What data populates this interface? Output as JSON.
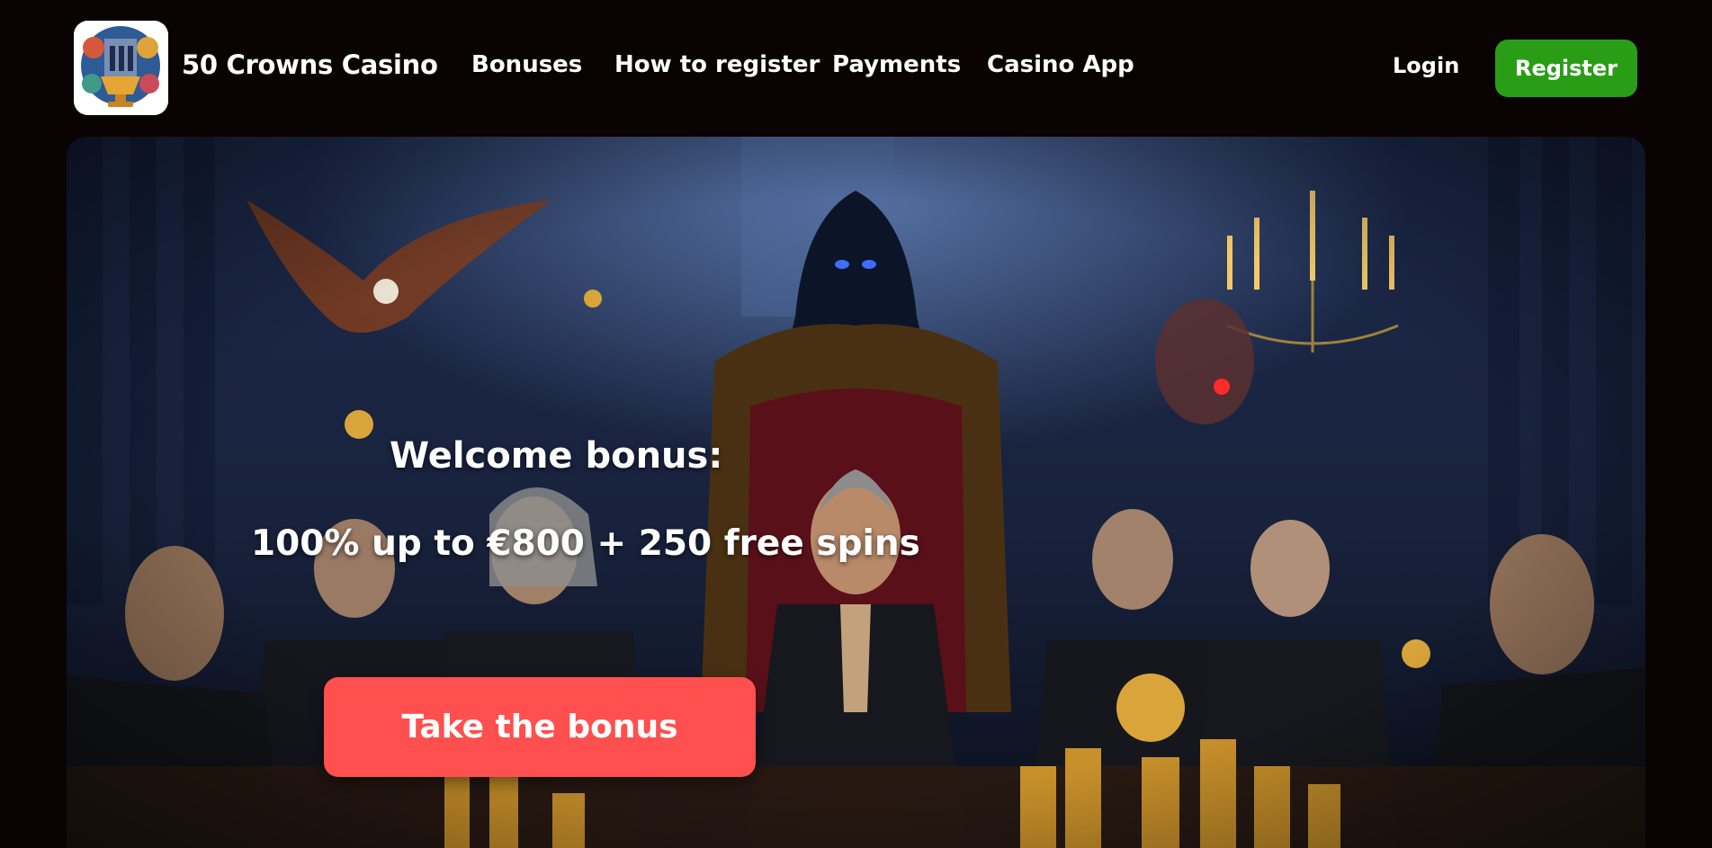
{
  "header": {
    "brand": "50 Crowns Casino",
    "nav": [
      {
        "label": "Bonuses"
      },
      {
        "label": "How to register"
      },
      {
        "label": "Payments"
      },
      {
        "label": "Casino App"
      }
    ],
    "login_label": "Login",
    "register_label": "Register"
  },
  "hero": {
    "welcome": "Welcome bonus:",
    "offer": "100% up to €800 + 250 free spins",
    "cta_label": "Take the bonus"
  },
  "colors": {
    "page_bg": "#0a0303",
    "register_green": "#2a9d17",
    "cta_red": "#ff4f4f",
    "hero_blue": "#0f1830"
  },
  "icons": {
    "logo": "casino-crest-logo"
  }
}
